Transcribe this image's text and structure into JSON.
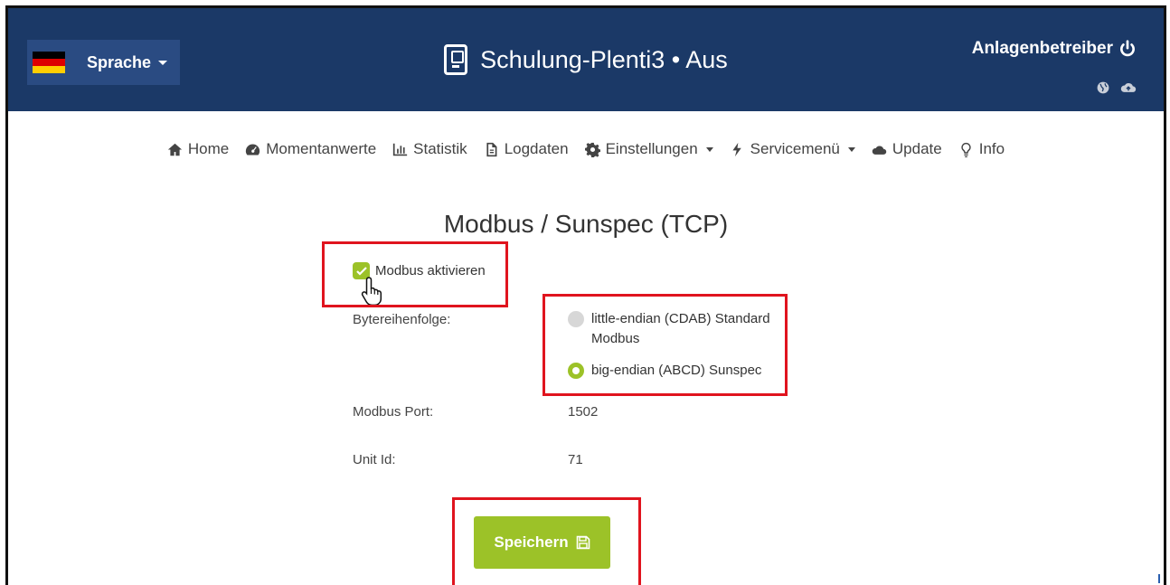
{
  "header": {
    "language_label": "Sprache",
    "title": "Schulung-Plenti3 • Aus",
    "user_label": "Anlagenbetreiber",
    "flag_colors": [
      "#000000",
      "#dd0000",
      "#ffce00"
    ],
    "icons": [
      "power-icon",
      "globe-icon",
      "cloud-upload-icon"
    ]
  },
  "nav": {
    "items": [
      {
        "label": "Home",
        "icon": "home-icon"
      },
      {
        "label": "Momentanwerte",
        "icon": "dashboard-icon"
      },
      {
        "label": "Statistik",
        "icon": "bar-chart-icon"
      },
      {
        "label": "Logdaten",
        "icon": "document-icon"
      },
      {
        "label": "Einstellungen",
        "icon": "gear-icon",
        "dropdown": true
      },
      {
        "label": "Servicemenü",
        "icon": "bolt-icon",
        "dropdown": true
      },
      {
        "label": "Update",
        "icon": "cloud-upload-icon"
      },
      {
        "label": "Info",
        "icon": "lightbulb-icon"
      }
    ]
  },
  "form": {
    "title": "Modbus / Sunspec (TCP)",
    "modbus_enable_label": "Modbus aktivieren",
    "modbus_enabled": true,
    "byte_order_label": "Bytereihenfolge:",
    "byte_order_options": [
      {
        "line1": "little-endian (CDAB) Standard",
        "line2": "Modbus",
        "selected": false
      },
      {
        "line1": "big-endian (ABCD) Sunspec",
        "line2": "",
        "selected": true
      }
    ],
    "port_label": "Modbus Port:",
    "port_value": "1502",
    "unit_id_label": "Unit Id:",
    "unit_id_value": "71",
    "save_label": "Speichern"
  },
  "colors": {
    "header_bg": "#1b3967",
    "accent_green": "#9cc228",
    "highlight_red": "#e0141e"
  }
}
